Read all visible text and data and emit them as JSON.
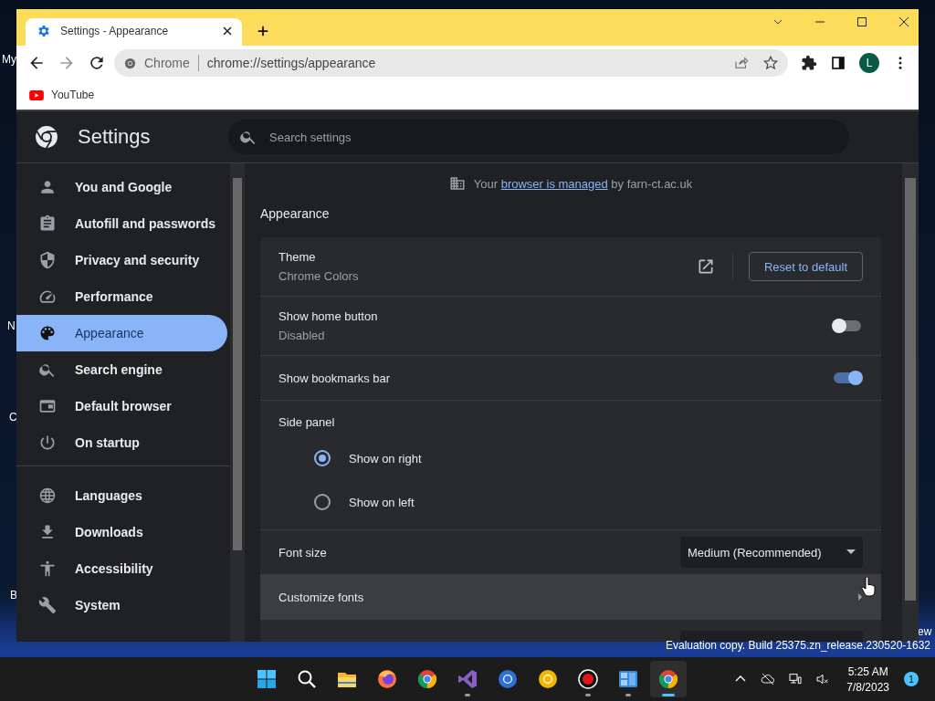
{
  "desktop": {
    "labels": [
      "My",
      "N",
      "C",
      "B",
      "ew"
    ],
    "watermark": "Evaluation copy. Build 25375.zn_release.230520-1632"
  },
  "browser": {
    "tab": {
      "title": "Settings - Appearance",
      "selected": true
    },
    "omnibox": {
      "chip": "Chrome",
      "url": "chrome://settings/appearance"
    },
    "avatar": "L",
    "bookmarks": [
      {
        "label": "YouTube"
      }
    ]
  },
  "settings": {
    "title": "Settings",
    "search": {
      "placeholder": "Search settings"
    },
    "sidebar": {
      "groups": [
        {
          "items": [
            {
              "label": "You and Google",
              "selected": false
            },
            {
              "label": "Autofill and passwords",
              "selected": false
            },
            {
              "label": "Privacy and security",
              "selected": false
            },
            {
              "label": "Performance",
              "selected": false
            },
            {
              "label": "Appearance",
              "selected": true
            },
            {
              "label": "Search engine",
              "selected": false
            },
            {
              "label": "Default browser",
              "selected": false
            },
            {
              "label": "On startup",
              "selected": false
            }
          ]
        },
        {
          "items": [
            {
              "label": "Languages",
              "selected": false
            },
            {
              "label": "Downloads",
              "selected": false
            },
            {
              "label": "Accessibility",
              "selected": false
            },
            {
              "label": "System",
              "selected": false
            }
          ]
        }
      ]
    },
    "managed_notice": {
      "before": "Your",
      "link": "browser is managed",
      "after": "by farn-ct.ac.uk"
    },
    "section_title": "Appearance",
    "rows": [
      {
        "kind": "theme",
        "title": "Theme",
        "subtitle": "Chrome Colors",
        "button": "Reset to default"
      },
      {
        "kind": "toggle",
        "title": "Show home button",
        "subtitle": "Disabled",
        "on": false
      },
      {
        "kind": "toggle",
        "title": "Show bookmarks bar",
        "on": true
      },
      {
        "kind": "radio",
        "title": "Side panel",
        "options": [
          {
            "label": "Show on right",
            "selected": true
          },
          {
            "label": "Show on left",
            "selected": false
          }
        ]
      },
      {
        "kind": "select",
        "title": "Font size",
        "value": "Medium (Recommended)"
      },
      {
        "kind": "link",
        "title": "Customize fonts",
        "highlighted": true
      },
      {
        "kind": "cut"
      }
    ]
  },
  "taskbar": {
    "apps": [
      {
        "running": false,
        "selected": false
      },
      {
        "running": false,
        "selected": false
      },
      {
        "running": false,
        "selected": false
      },
      {
        "running": false,
        "selected": false
      },
      {
        "running": false,
        "selected": false
      },
      {
        "running": true,
        "selected": false
      },
      {
        "running": false,
        "selected": false
      },
      {
        "running": false,
        "selected": false
      },
      {
        "running": true,
        "selected": false
      },
      {
        "running": true,
        "selected": false
      },
      {
        "running": true,
        "selected": true
      }
    ],
    "time": "5:25 AM",
    "date": "7/8/2023",
    "notifications": "1"
  }
}
